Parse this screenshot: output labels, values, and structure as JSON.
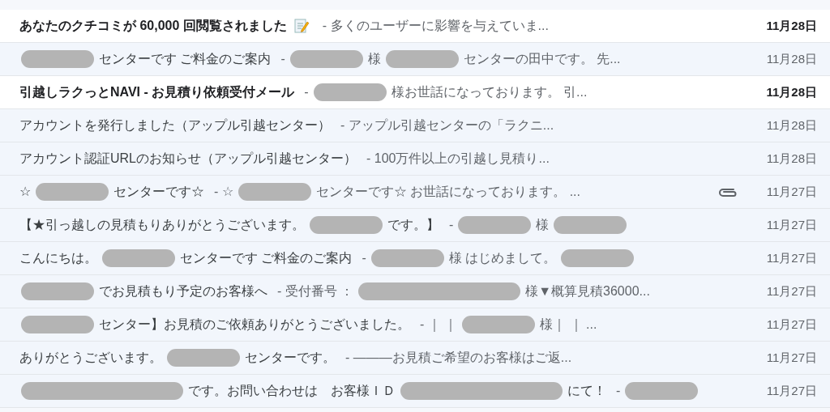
{
  "messages": [
    {
      "unread": true,
      "attachment": false,
      "subject": [
        {
          "kind": "text",
          "text": "あなたのクチコミが 60,000 回閲覧されました"
        },
        {
          "kind": "memo"
        }
      ],
      "snippet": [
        {
          "kind": "text",
          "text": "- 多くのユーザーに影響を与えていま..."
        }
      ],
      "date": "11月28日"
    },
    {
      "unread": false,
      "attachment": false,
      "subject": [
        {
          "kind": "redaction",
          "wide": false
        },
        {
          "kind": "text",
          "text": "センターです ご料金のご案内"
        }
      ],
      "snippet": [
        {
          "kind": "text",
          "text": "-"
        },
        {
          "kind": "redaction",
          "wide": false
        },
        {
          "kind": "text",
          "text": "様"
        },
        {
          "kind": "redaction",
          "wide": false
        },
        {
          "kind": "text",
          "text": "センターの田中です。 先..."
        }
      ],
      "date": "11月28日"
    },
    {
      "unread": true,
      "attachment": false,
      "subject": [
        {
          "kind": "text",
          "text": "引越しラクっとNAVI - お見積り依頼受付メール"
        }
      ],
      "snippet": [
        {
          "kind": "text",
          "text": "-"
        },
        {
          "kind": "redaction",
          "wide": false
        },
        {
          "kind": "text",
          "text": "様お世話になっております。 引..."
        }
      ],
      "date": "11月28日"
    },
    {
      "unread": false,
      "attachment": false,
      "subject": [
        {
          "kind": "text",
          "text": "アカウントを発行しました（アップル引越センター）"
        }
      ],
      "snippet": [
        {
          "kind": "text",
          "text": "- アップル引越センターの「ラクニ..."
        }
      ],
      "date": "11月28日"
    },
    {
      "unread": false,
      "attachment": false,
      "subject": [
        {
          "kind": "text",
          "text": "アカウント認証URLのお知らせ（アップル引越センター）"
        }
      ],
      "snippet": [
        {
          "kind": "text",
          "text": "- 100万件以上の引越し見積り..."
        }
      ],
      "date": "11月28日"
    },
    {
      "unread": false,
      "attachment": true,
      "subject": [
        {
          "kind": "text",
          "text": "☆"
        },
        {
          "kind": "redaction",
          "wide": false
        },
        {
          "kind": "text",
          "text": "センターです☆"
        }
      ],
      "snippet": [
        {
          "kind": "text",
          "text": "- ☆"
        },
        {
          "kind": "redaction",
          "wide": false
        },
        {
          "kind": "text",
          "text": "センターです☆ お世話になっております。 ..."
        }
      ],
      "date": "11月27日"
    },
    {
      "unread": false,
      "attachment": false,
      "subject": [
        {
          "kind": "text",
          "text": "【★引っ越しの見積もりありがとうございます。"
        },
        {
          "kind": "redaction",
          "wide": false
        },
        {
          "kind": "text",
          "text": "です。】"
        }
      ],
      "snippet": [
        {
          "kind": "text",
          "text": "-"
        },
        {
          "kind": "redaction",
          "wide": false
        },
        {
          "kind": "text",
          "text": "様"
        },
        {
          "kind": "redaction",
          "wide": false
        }
      ],
      "date": "11月27日"
    },
    {
      "unread": false,
      "attachment": false,
      "subject": [
        {
          "kind": "text",
          "text": "こんにちは。"
        },
        {
          "kind": "redaction",
          "wide": false
        },
        {
          "kind": "text",
          "text": "センターです ご料金のご案内"
        }
      ],
      "snippet": [
        {
          "kind": "text",
          "text": "-"
        },
        {
          "kind": "redaction",
          "wide": false
        },
        {
          "kind": "text",
          "text": "様 はじめまして。"
        },
        {
          "kind": "redaction",
          "wide": false
        }
      ],
      "date": "11月27日"
    },
    {
      "unread": false,
      "attachment": false,
      "subject": [
        {
          "kind": "redaction",
          "wide": false
        },
        {
          "kind": "text",
          "text": "でお見積もり予定のお客様へ"
        }
      ],
      "snippet": [
        {
          "kind": "text",
          "text": "- 受付番号 ："
        },
        {
          "kind": "redaction",
          "wide": true
        },
        {
          "kind": "text",
          "text": "様▼概算見積36000..."
        }
      ],
      "date": "11月27日"
    },
    {
      "unread": false,
      "attachment": false,
      "subject": [
        {
          "kind": "redaction",
          "wide": false
        },
        {
          "kind": "text",
          "text": "センター】お見積のご依頼ありがとうございました。"
        }
      ],
      "snippet": [
        {
          "kind": "text",
          "text": "- ｜ ｜"
        },
        {
          "kind": "redaction",
          "wide": false
        },
        {
          "kind": "text",
          "text": "様｜ ｜ ..."
        }
      ],
      "date": "11月27日"
    },
    {
      "unread": false,
      "attachment": false,
      "subject": [
        {
          "kind": "text",
          "text": "ありがとうございます。"
        },
        {
          "kind": "redaction",
          "wide": false
        },
        {
          "kind": "text",
          "text": "センターです。"
        }
      ],
      "snippet": [
        {
          "kind": "text",
          "text": "- ―――お見積ご希望のお客様はご返..."
        }
      ],
      "date": "11月27日"
    },
    {
      "unread": false,
      "attachment": false,
      "subject": [
        {
          "kind": "redaction",
          "wide": true
        },
        {
          "kind": "text",
          "text": "です。お問い合わせは　お客様ＩＤ"
        },
        {
          "kind": "redaction",
          "wide": true
        },
        {
          "kind": "text",
          "text": "にて！"
        }
      ],
      "snippet": [
        {
          "kind": "text",
          "text": "-"
        },
        {
          "kind": "redaction",
          "wide": false
        }
      ],
      "date": "11月27日"
    }
  ]
}
